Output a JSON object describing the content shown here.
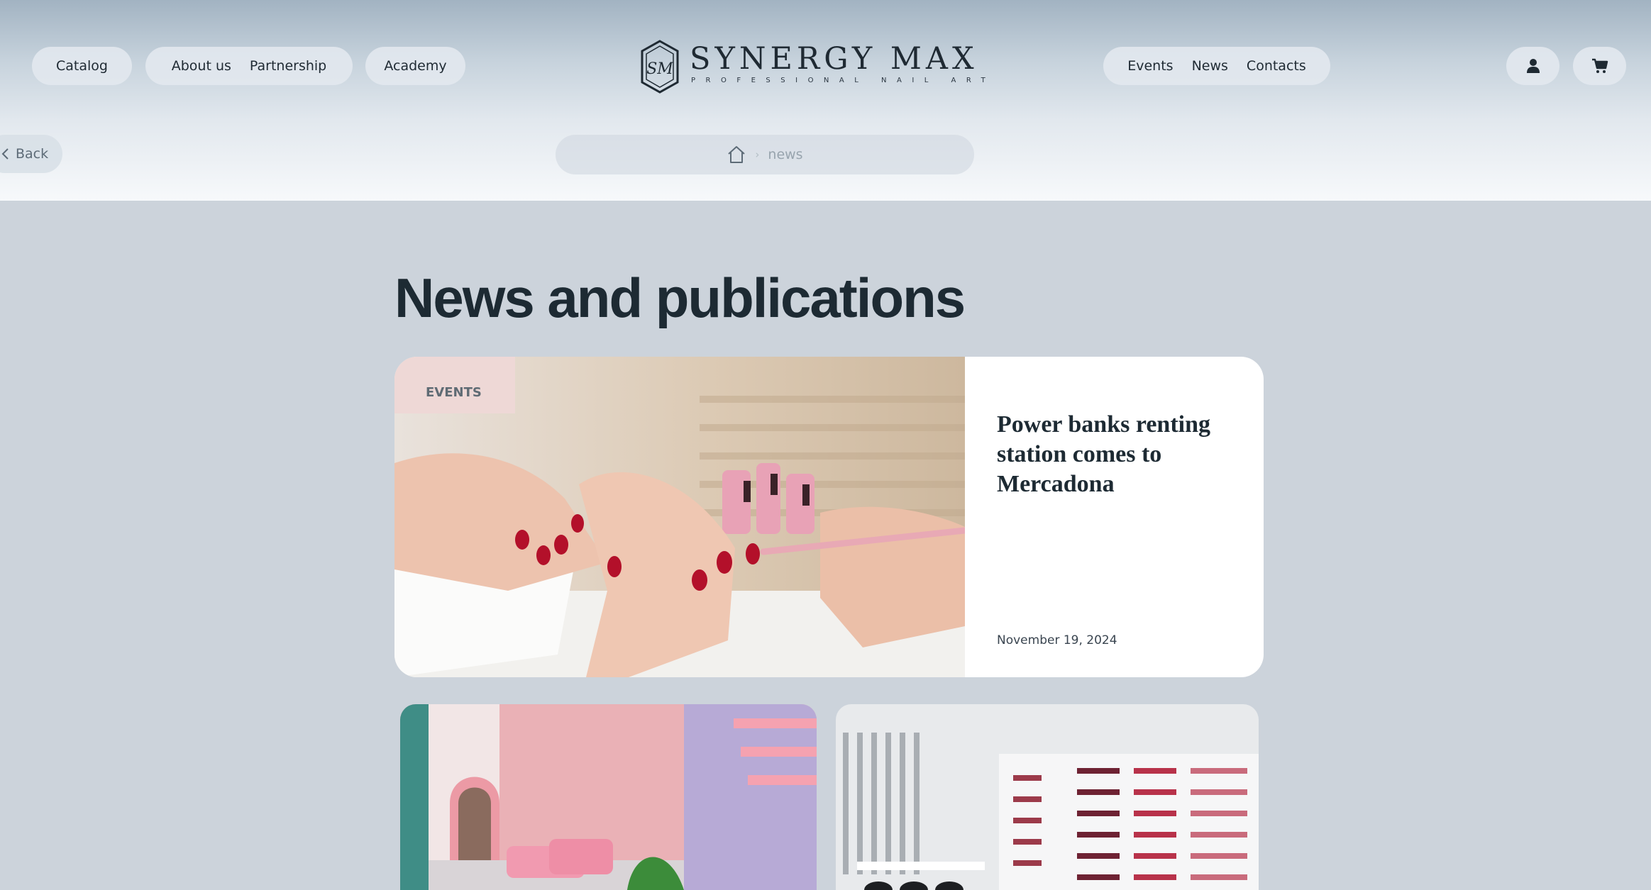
{
  "nav": {
    "catalog": "Catalog",
    "about": "About us",
    "partnership": "Partnership",
    "academy": "Academy",
    "events": "Events",
    "news": "News",
    "contacts": "Contacts"
  },
  "brand": {
    "name": "SYNERGY MAX",
    "tagline": "PROFESSIONAL NAIL ART",
    "monogram": "SM"
  },
  "icons": {
    "account": "user-icon",
    "cart": "cart-icon",
    "home": "home-icon",
    "back": "chevron-left-icon"
  },
  "back": {
    "label": "Back"
  },
  "breadcrumb": {
    "separator": "›",
    "current": "news"
  },
  "page": {
    "title": "News and publications"
  },
  "featured": {
    "category": "EVENTS",
    "title": "Power banks renting station comes to Mercadona",
    "date": "November 19, 2024"
  },
  "colors": {
    "background": "#ccd3db",
    "text_dark": "#1d2a33",
    "card": "#ffffff",
    "nail_red": "#b3102a"
  }
}
